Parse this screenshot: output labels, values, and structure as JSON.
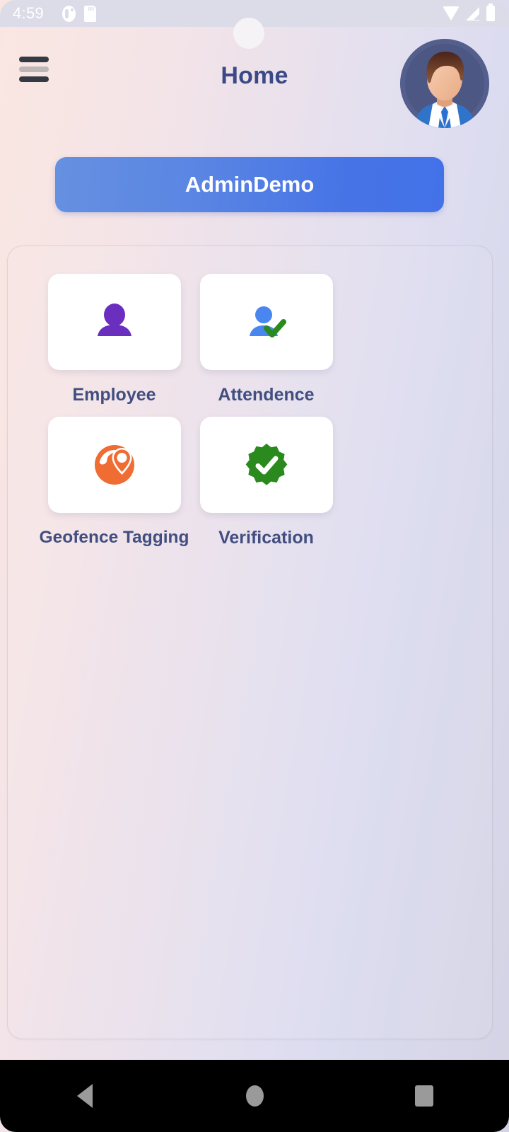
{
  "status_bar": {
    "time": "4:59",
    "left_icons": [
      "app-notification-icon",
      "sd-card-icon"
    ],
    "right_icons": [
      "wifi-icon",
      "cellular-signal-icon",
      "battery-icon"
    ]
  },
  "app_bar": {
    "menu_icon": "hamburger-menu-icon",
    "title": "Home",
    "avatar_icon": "user-avatar-icon"
  },
  "admin_button": {
    "label": "AdminDemo"
  },
  "tiles": [
    {
      "label": "Employee",
      "icon": "person-icon",
      "color": "#6a2fbf"
    },
    {
      "label": "Attendence",
      "icon": "person-check-icon",
      "color": "#4a86ef"
    },
    {
      "label": "Geofence Tagging",
      "icon": "globe-location-pin-icon",
      "color": "#ef6c33"
    },
    {
      "label": "Verification",
      "icon": "verified-badge-icon",
      "color": "#2a8a1e"
    }
  ],
  "nav_bar": {
    "back": "back-triangle-icon",
    "home": "home-circle-icon",
    "recents": "recents-square-icon"
  },
  "colors": {
    "title": "#3b4a87",
    "tile_label": "#424e80",
    "button_gradient_start": "#6690e0",
    "button_gradient_end": "#4372e8",
    "background_start": "#fae6e1",
    "background_end": "#d3d3e4"
  }
}
